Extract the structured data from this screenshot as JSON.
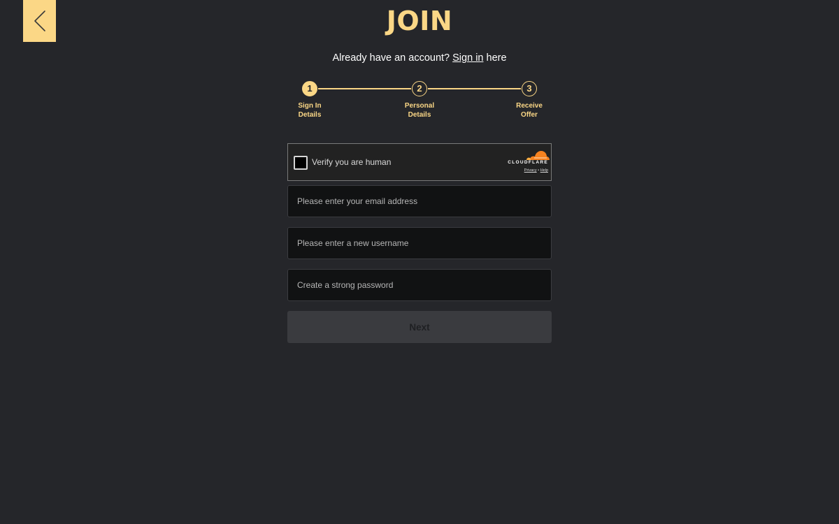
{
  "page": {
    "title": "JOIN"
  },
  "signin": {
    "prefix": "Already have an account? ",
    "link": "Sign in",
    "suffix": " here"
  },
  "stepper": {
    "steps": [
      {
        "number": "1",
        "label_line1": "Sign In",
        "label_line2": "Details",
        "state": "active"
      },
      {
        "number": "2",
        "label_line1": "Personal",
        "label_line2": "Details",
        "state": "pending"
      },
      {
        "number": "3",
        "label_line1": "Receive",
        "label_line2": "Offer",
        "state": "pending"
      }
    ]
  },
  "captcha": {
    "label": "Verify you are human",
    "brand": "CLOUDFLARE",
    "privacy_link": "Privacy",
    "separator": "•",
    "help_link": "Help",
    "checked": false
  },
  "form": {
    "email": {
      "value": "",
      "placeholder": "Please enter your email address"
    },
    "username": {
      "value": "",
      "placeholder": "Please enter a new username"
    },
    "password": {
      "value": "",
      "placeholder": "Create a strong password"
    },
    "next_label": "Next",
    "next_enabled": false
  },
  "icons": {
    "back": "chevron-left-icon",
    "captcha_logo": "cloudflare-cloud-icon"
  },
  "colors": {
    "accent": "#fbd786",
    "background": "#25262a",
    "input_bg": "#111213",
    "button_disabled": "#3a3b3f",
    "cloudflare_orange": "#f6821f"
  }
}
